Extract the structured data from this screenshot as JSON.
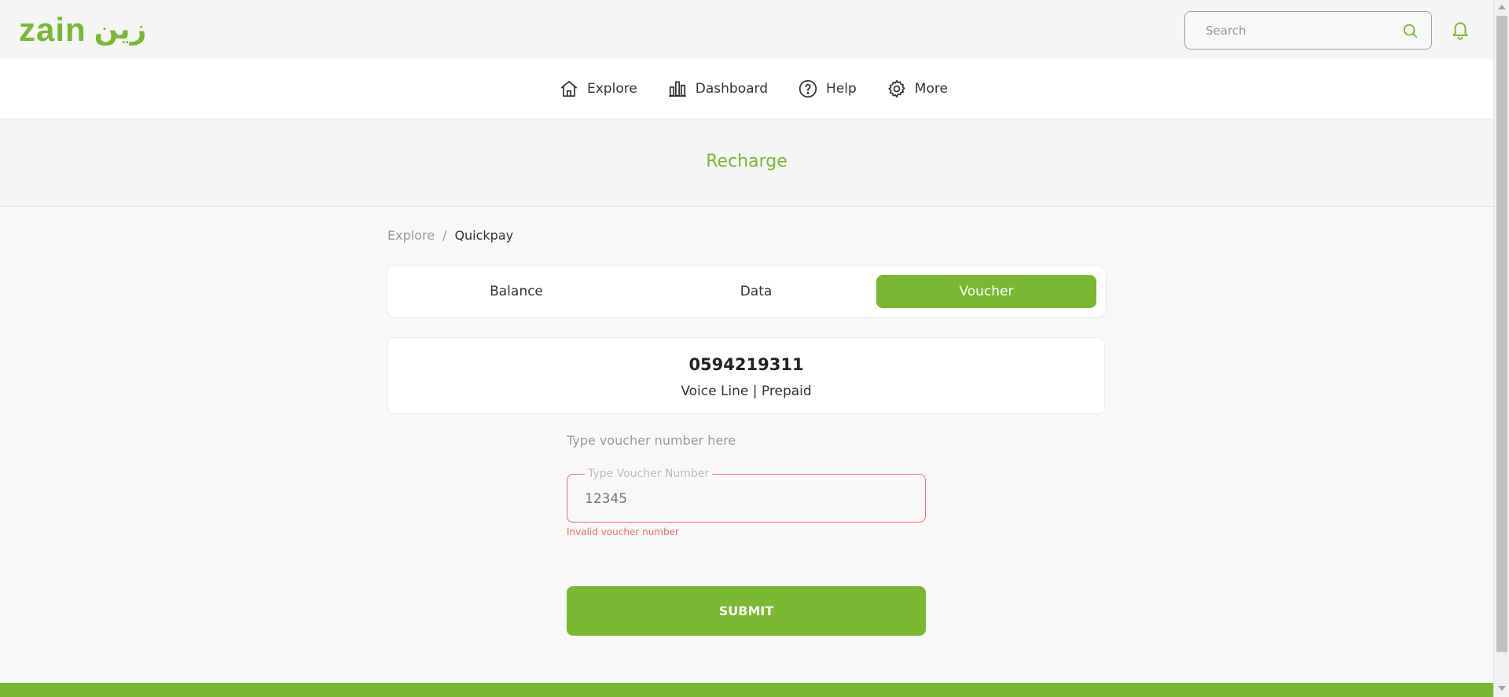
{
  "brand": {
    "logo_latin": "zain",
    "logo_arabic": "زين",
    "accent_color": "#7ab733",
    "error_color": "#e86e6e"
  },
  "header": {
    "search_placeholder": "Search",
    "search_icon": "search-icon",
    "notification_icon": "bell-icon"
  },
  "nav": {
    "items": [
      {
        "label": "Explore",
        "icon": "home-icon"
      },
      {
        "label": "Dashboard",
        "icon": "bar-chart-icon"
      },
      {
        "label": "Help",
        "icon": "help-circle-icon"
      },
      {
        "label": "More",
        "icon": "gear-icon"
      }
    ]
  },
  "page": {
    "title": "Recharge"
  },
  "breadcrumb": {
    "parent": "Explore",
    "separator": "/",
    "current": "Quickpay"
  },
  "tabs": [
    {
      "label": "Balance",
      "active": false
    },
    {
      "label": "Data",
      "active": false
    },
    {
      "label": "Voucher",
      "active": true
    }
  ],
  "line": {
    "number": "0594219311",
    "type": "Voice Line | Prepaid"
  },
  "voucher": {
    "hint": "Type voucher number here",
    "field_label": "Type Voucher Number",
    "placeholder": "12345",
    "value": "",
    "error": "Invalid voucher number"
  },
  "actions": {
    "submit_label": "SUBMIT"
  }
}
